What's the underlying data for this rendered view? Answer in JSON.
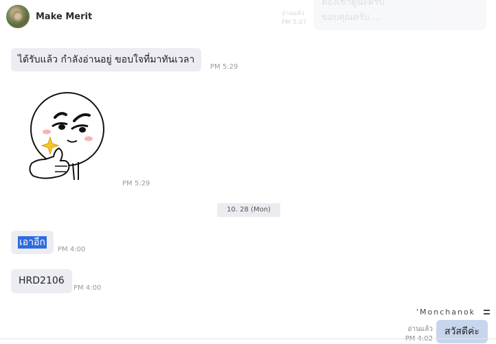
{
  "header": {
    "contact_name": "Make Merit"
  },
  "ghost_message": {
    "line1": "ต้องเข้าดูนะครับ",
    "line2": "ขอบคุณครับ ...",
    "meta1": "อ่านแล้ว",
    "meta2": "PM 5:27"
  },
  "messages": [
    {
      "text": "ได้รับแล้ว กำลังอ่านอยู่ ขอบใจที่มาทันเวลา",
      "time": "PM 5:29"
    },
    {
      "sticker": "thumbs-up-sticker",
      "time": "PM 5:29"
    },
    {
      "text_selected": "เอาอีก",
      "time": "PM 4:00"
    },
    {
      "text": "HRD2106",
      "time": "PM 4:00"
    }
  ],
  "date_badge": "10. 28 (Mon)",
  "outgoing": {
    "sender": "'Monchanok",
    "read_label": "อ่านแล้ว",
    "time": "PM 4:02",
    "text": "สวัสดีค่ะ"
  },
  "colors": {
    "incoming_bubble": "#ececf3",
    "outgoing_bubble": "#c7d6ee",
    "selection": "#2e6ce0"
  }
}
